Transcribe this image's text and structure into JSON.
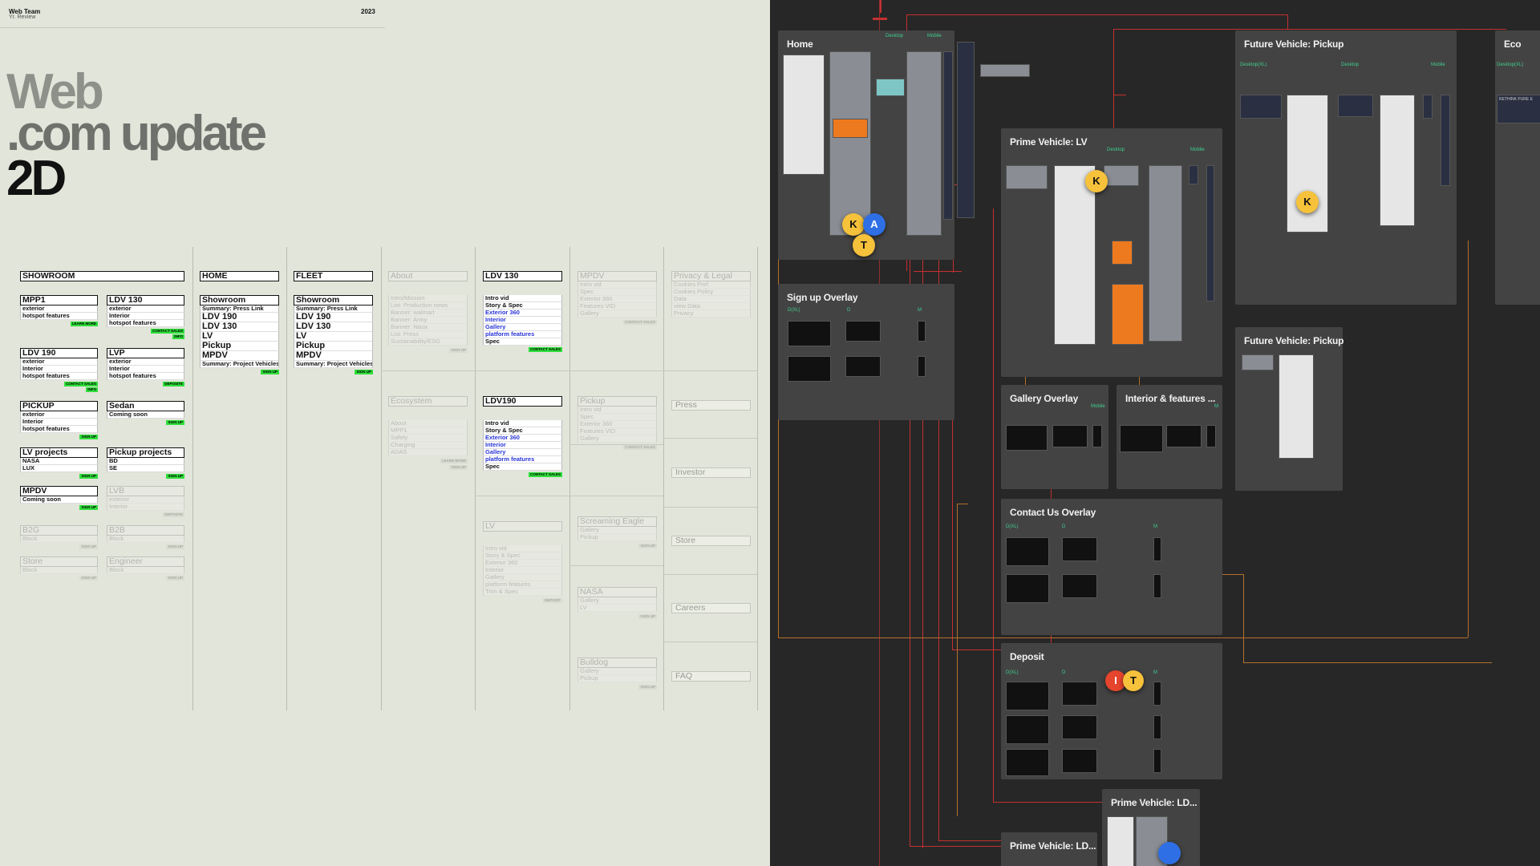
{
  "header": {
    "team": "Web Team",
    "subtitle": "Yr. Review",
    "year": "2023"
  },
  "title": {
    "line1": "Web",
    "line2": ".com update",
    "line3": "2D"
  },
  "showroom": {
    "heading": "SHOWROOM",
    "cards": [
      {
        "title": "MPP1",
        "lines": [
          "exterior",
          "hotspot features"
        ],
        "tag": "LEARN MORE"
      },
      {
        "title": "LDV 130",
        "lines": [
          "exterior",
          "Interior",
          "hotspot features"
        ],
        "tag": "CONTACT SALES",
        "tag2": "INFO"
      },
      {
        "title": "LDV 190",
        "lines": [
          "exterior",
          "Interior",
          "hotspot features"
        ],
        "tag": "CONTACT SALES",
        "tag2": "INFO"
      },
      {
        "title": "LVP",
        "lines": [
          "exterior",
          "Interior",
          "hotspot features"
        ],
        "tag": "DEPOSITE"
      },
      {
        "title": "PICKUP",
        "lines": [
          "exterior",
          "Interior",
          "hotspot features"
        ],
        "tag": "SIGN UP"
      },
      {
        "title": "Sedan",
        "lines": [
          "Coming soon"
        ],
        "tag": "SIGN UP"
      },
      {
        "title": "LV projects",
        "lines": [
          "NASA",
          "LUX"
        ],
        "tag": "SIGN UP"
      },
      {
        "title": "Pickup projects",
        "lines": [
          "BD",
          "SE"
        ],
        "tag": "SIGN UP"
      },
      {
        "title": "MPDV",
        "lines": [
          "Coming soon"
        ],
        "tag": "SIGN UP"
      },
      {
        "title": "LVB",
        "lines": [
          "exterior",
          "Interior"
        ],
        "tag": "DEPOSITE"
      },
      {
        "title": "B2G",
        "lines": [
          "Block"
        ],
        "tag": "SIGN UP"
      },
      {
        "title": "B2B",
        "lines": [
          "Block"
        ],
        "tag": "SIGN UP"
      },
      {
        "title": "Store",
        "lines": [
          "Block"
        ],
        "tag": "SIGN UP"
      },
      {
        "title": "Engineer",
        "lines": [
          "Block"
        ],
        "tag": "SIGN UP"
      }
    ]
  },
  "home": {
    "heading": "HOME",
    "title": "Showroom",
    "lines": [
      "Summary: Press Link",
      "LDV 190",
      "LDV 130",
      "LV",
      "Pickup",
      "MPDV",
      "Summary: Project Vehicles"
    ],
    "tag": "SIGN UP"
  },
  "fleet": {
    "heading": "FLEET",
    "title": "Showroom",
    "lines": [
      "Summary: Press Link",
      "LDV 190",
      "LDV 130",
      "LV",
      "Pickup",
      "MPDV",
      "Summary: Project Vehicles"
    ],
    "tag": "SIGN UP"
  },
  "about": {
    "heading": "About",
    "lines": [
      "Intro/Mission",
      "List: Production news",
      "Banner: walmart",
      "Banner: Army",
      "Banner: Nasa",
      "List: Press",
      "Sustainability/ESG"
    ],
    "tag": "SIGN UP"
  },
  "ecosystem": {
    "heading": "Ecosystem",
    "lines": [
      "About",
      "MPP1",
      "Safety",
      "Charging",
      "ADAS"
    ],
    "tag": "LEARN MORE",
    "tag2": "SIGN UP"
  },
  "ldv130": {
    "heading": "LDV 130",
    "lines": [
      "Intro vid",
      "Story & Spec",
      "Exterior 360",
      "Interior",
      "Gallery",
      "platform features",
      "Spec"
    ],
    "tag": "CONTACT SALES"
  },
  "ldv190": {
    "heading": "LDV190",
    "lines": [
      "Intro vid",
      "Story & Spec",
      "Exterior 360",
      "Interior",
      "Gallery",
      "platform features",
      "Spec"
    ],
    "tag": "CONTACT SALES"
  },
  "lv": {
    "heading": "LV",
    "lines": [
      "Intro vid",
      "Story & Spec",
      "Exterior 360",
      "Interior",
      "Gallery",
      "platform features",
      "Trim & Spec"
    ],
    "tag": "DEPOSIT"
  },
  "mpdv": {
    "heading": "MPDV",
    "lines": [
      "Intro vid",
      "Spec",
      "Exterior 360",
      "Features VID",
      "Gallery"
    ],
    "tag": "CONTACT SALES"
  },
  "pickup": {
    "heading": "Pickup",
    "lines": [
      "Intro vid",
      "Spec",
      "Exterior 360",
      "Features VID",
      "Gallery"
    ],
    "tag": "CONTACT SALES"
  },
  "eagle": {
    "heading": "Screaming Eagle",
    "lines": [
      "Gallery",
      "Pickup"
    ],
    "tag": "SIGN UP"
  },
  "nasa": {
    "heading": "NASA",
    "lines": [
      "Gallery",
      "LV"
    ],
    "tag": "SIGN UP"
  },
  "bulldog": {
    "heading": "Bulldog",
    "lines": [
      "Gallery",
      "Pickup"
    ],
    "tag": "SIGN UP"
  },
  "privacy": {
    "heading": "Privacy & Legal",
    "lines": [
      "Cookies Pref.",
      "Cookies Policy",
      "Data",
      "view Data",
      "Privacy"
    ]
  },
  "side_links": [
    "Press",
    "Investor",
    "Store",
    "Careers",
    "FAQ"
  ],
  "canvas": {
    "frames": {
      "home": {
        "title": "Home",
        "desktop": "Desktop",
        "mobile": "Mobile"
      },
      "prime_lv": {
        "title": "Prime Vehicle: LV",
        "desktop": "Desktop",
        "mobile": "Mobile"
      },
      "future_pickup": {
        "title": "Future Vehicle: Pickup",
        "l1": "Desktop(XL)",
        "l2": "Desktop",
        "l3": "Mobile"
      },
      "eco": {
        "title": "Eco",
        "l1": "Desktop(XL)",
        "banner": "RETHINK PURE E"
      },
      "signup": {
        "title": "Sign up Overlay",
        "l1": "D(XL)",
        "l2": "D",
        "l3": "M"
      },
      "future_pickup2": {
        "title": "Future Vehicle: Pickup"
      },
      "gallery": {
        "title": "Gallery Overlay",
        "l1": "Mobile"
      },
      "interior": {
        "title": "Interior & features ...",
        "l1": "M"
      },
      "contact": {
        "title": "Contact Us Overlay",
        "l1": "D(XL)",
        "l2": "D",
        "l3": "M"
      },
      "deposit": {
        "title": "Deposit",
        "l1": "D(XL)",
        "l2": "D",
        "l3": "M"
      },
      "prime_ld1": {
        "title": "Prime Vehicle: LD..."
      },
      "prime_ld2": {
        "title": "Prime Vehicle: LD..."
      }
    },
    "avatars": [
      "K",
      "A",
      "T",
      "K",
      "K",
      "I",
      "T"
    ],
    "colors": {
      "green_tag": "#2fdf3b",
      "blue_text": "#2a36d8",
      "canvas_bg": "#272727",
      "frame_bg": "#434343",
      "wire_red": "#c53030",
      "wire_orange": "#b5702b",
      "avatar_yellow": "#f6c13b",
      "avatar_blue": "#2f6fe6",
      "avatar_red": "#e5442d"
    }
  }
}
